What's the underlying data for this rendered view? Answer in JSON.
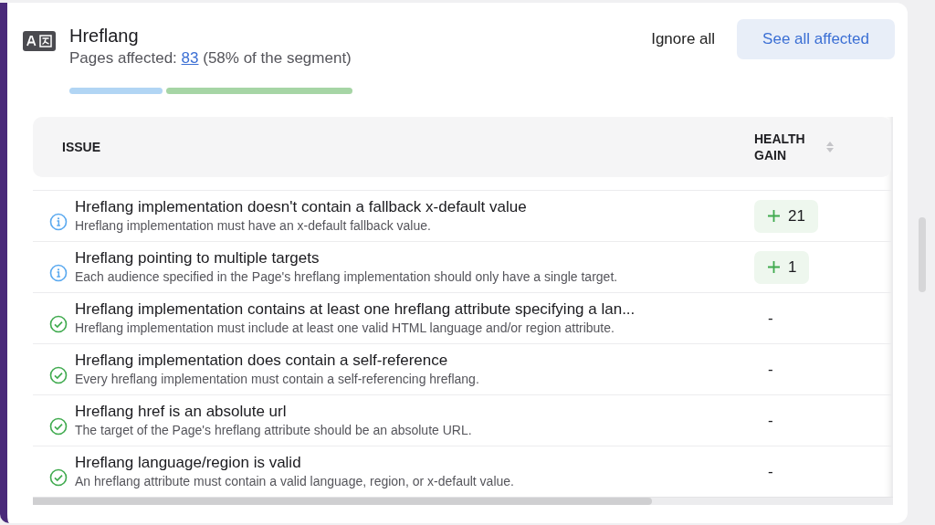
{
  "header": {
    "title": "Hreflang",
    "pages_label": "Pages affected:",
    "pages_count": "83",
    "pages_share": "(58% of the segment)"
  },
  "segments": [
    {
      "color": "#b1d5f4"
    },
    {
      "color": "#a6d5a5"
    }
  ],
  "actions": {
    "ignore": "Ignore all",
    "see_all": "See all affected"
  },
  "table": {
    "columns": [
      "ISSUE",
      "HEALTH GAIN"
    ],
    "rows": [
      {
        "kind": "info",
        "title": "Hreflang implementation doesn't contain a fallback x-default value",
        "description": "Hreflang implementation must have an x-default fallback value.",
        "gain": {
          "kind": "badge",
          "value": "21"
        }
      },
      {
        "kind": "info",
        "title": "Hreflang pointing to multiple targets",
        "description": "Each audience specified in the Page's hreflang implementation should only have a single target.",
        "gain": {
          "kind": "badge",
          "value": "1"
        }
      },
      {
        "kind": "check",
        "title": "Hreflang implementation contains at least one hreflang attribute specifying a lan...",
        "description": "Hreflang implementation must include at least one valid HTML language and/or region attribute.",
        "gain": {
          "kind": "dash",
          "value": "-"
        }
      },
      {
        "kind": "check",
        "title": "Hreflang implementation does contain a self-reference",
        "description": "Every hreflang implementation must contain a self-referencing hreflang.",
        "gain": {
          "kind": "dash",
          "value": "-"
        }
      },
      {
        "kind": "check",
        "title": "Hreflang href is an absolute url",
        "description": "The target of the Page's hreflang attribute should be an absolute URL.",
        "gain": {
          "kind": "dash",
          "value": "-"
        }
      },
      {
        "kind": "check",
        "title": "Hreflang language/region is valid",
        "description": "An hreflang attribute must contain a valid language, region, or x-default value.",
        "gain": {
          "kind": "dash",
          "value": "-"
        }
      }
    ]
  }
}
